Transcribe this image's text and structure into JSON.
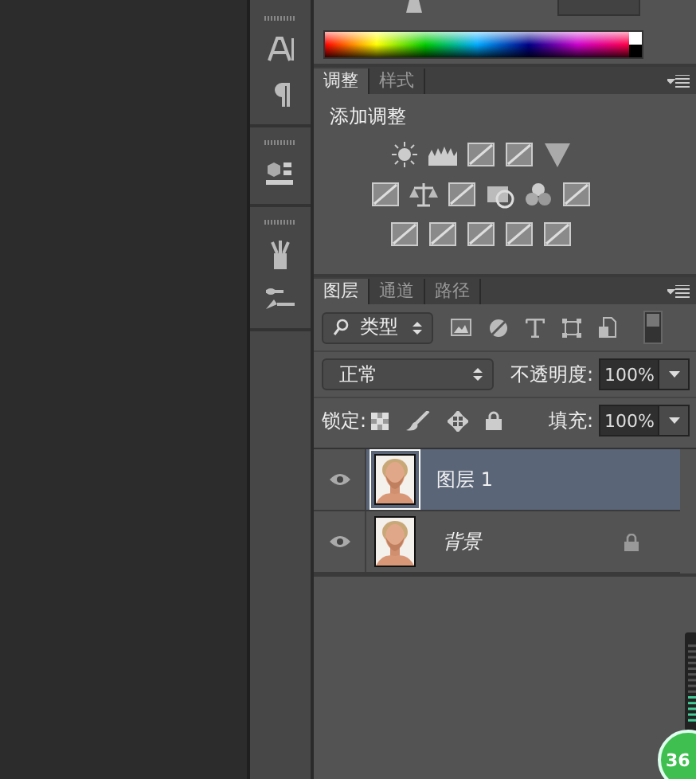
{
  "adjustments_panel": {
    "tabs": [
      {
        "label": "调整",
        "selected": true
      },
      {
        "label": "样式",
        "selected": false
      }
    ],
    "heading": "添加调整"
  },
  "layers_panel": {
    "tabs": [
      {
        "label": "图层",
        "selected": true
      },
      {
        "label": "通道",
        "selected": false
      },
      {
        "label": "路径",
        "selected": false
      }
    ],
    "filter": {
      "value": "类型"
    },
    "blend_mode": {
      "value": "正常"
    },
    "opacity": {
      "label": "不透明度:",
      "value": "100%"
    },
    "lock": {
      "label": "锁定:"
    },
    "fill": {
      "label": "填充:",
      "value": "100%"
    },
    "layers": [
      {
        "name": "图层 1",
        "kind": "layer",
        "selected": true,
        "visible": true,
        "locked": false
      },
      {
        "name": "背景",
        "kind": "background",
        "selected": false,
        "visible": true,
        "locked": true
      }
    ]
  },
  "tray_badge": {
    "text": "36"
  }
}
